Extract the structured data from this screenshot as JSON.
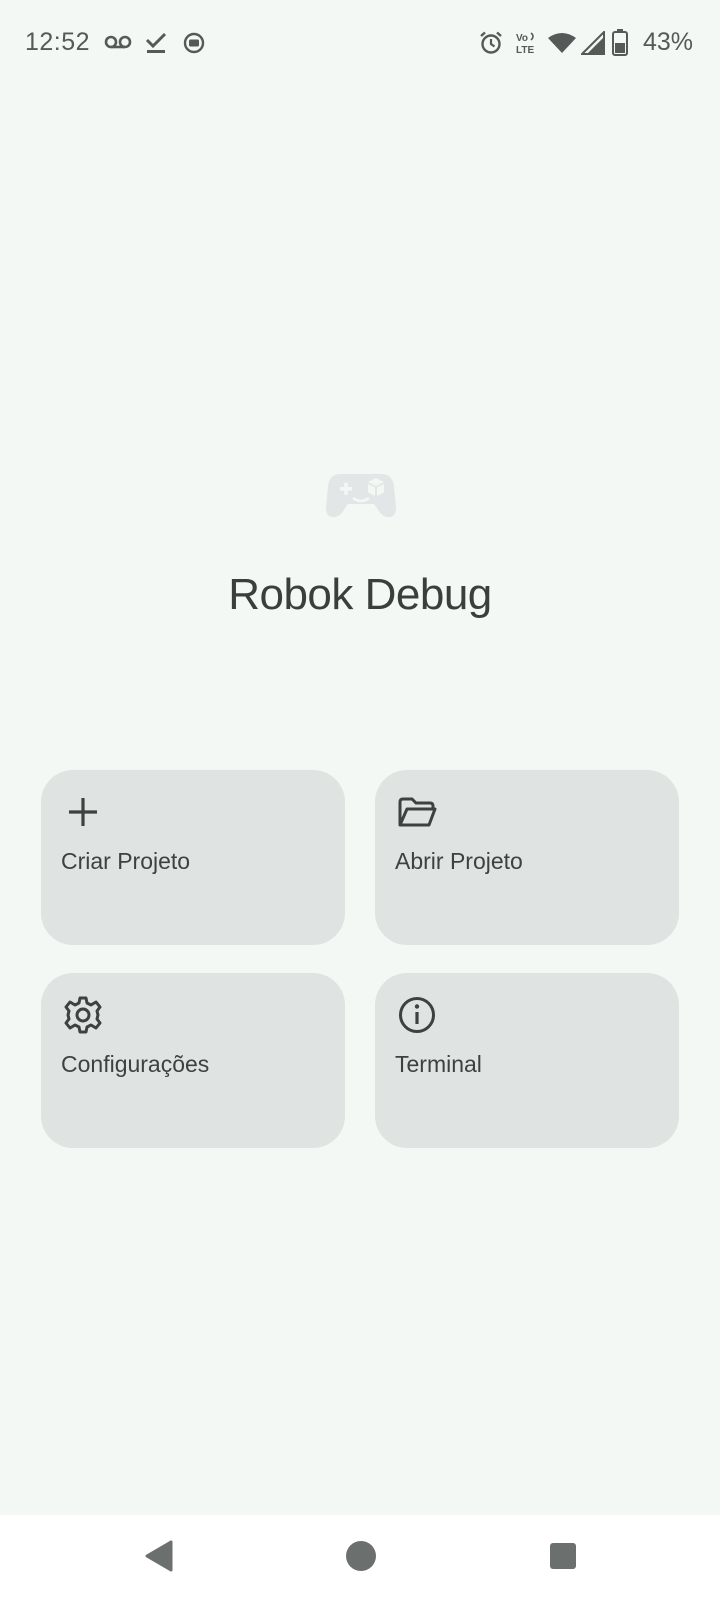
{
  "status_bar": {
    "time": "12:52",
    "battery_percent": "43%",
    "left_icons": [
      "voicemail-icon",
      "download-done-icon",
      "screen-record-icon"
    ],
    "right_icons": [
      "alarm-icon",
      "volte-icon",
      "wifi-icon",
      "cell-signal-icon",
      "battery-icon"
    ]
  },
  "hero": {
    "icon": "gamepad-icon",
    "title": "Robok Debug"
  },
  "actions": [
    {
      "label": "Criar Projeto",
      "icon": "plus-icon"
    },
    {
      "label": "Abrir Projeto",
      "icon": "folder-open-icon"
    },
    {
      "label": "Configurações",
      "icon": "gear-icon"
    },
    {
      "label": "Terminal",
      "icon": "info-icon"
    }
  ],
  "nav_bar": {
    "buttons": [
      "back-icon",
      "home-icon",
      "recents-icon"
    ]
  },
  "colors": {
    "background": "#f3f8f5",
    "card": "#dfe4e2",
    "text": "#3d4240",
    "nav_background": "#ffffff"
  }
}
